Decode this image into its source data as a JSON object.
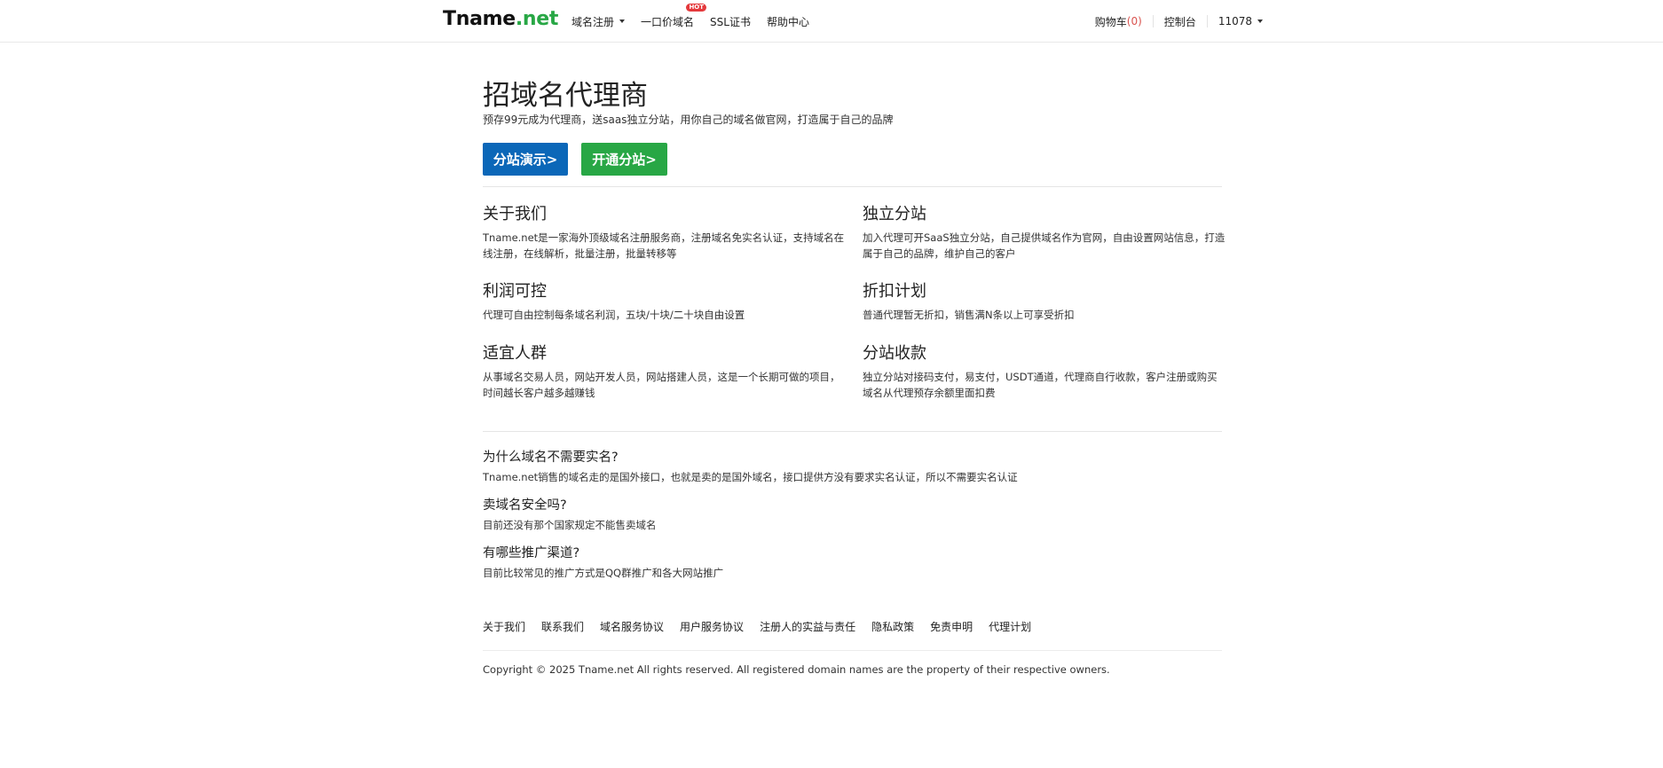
{
  "header": {
    "logo_main": "Tname",
    "logo_suffix": ".net",
    "nav": [
      {
        "label": "域名注册",
        "has_caret": true
      },
      {
        "label": "一口价域名",
        "badge": "HOT"
      },
      {
        "label": "SSL证书"
      },
      {
        "label": "帮助中心"
      }
    ],
    "cart_label": "购物车",
    "cart_count": "(0)",
    "console_label": "控制台",
    "user_label": "11078"
  },
  "hero": {
    "title": "招域名代理商",
    "subtitle": "预存99元成为代理商，送saas独立分站，用你自己的域名做官网，打造属于自己的品牌",
    "demo_button": "分站演示>",
    "open_button": "开通分站>"
  },
  "features": [
    {
      "title": "关于我们",
      "text": "Tname.net是一家海外顶级域名注册服务商，注册域名免实名认证，支持域名在线注册，在线解析，批量注册，批量转移等"
    },
    {
      "title": "独立分站",
      "text": "加入代理可开SaaS独立分站，自己提供域名作为官网，自由设置网站信息，打造属于自己的品牌，维护自己的客户"
    },
    {
      "title": "利润可控",
      "text": "代理可自由控制每条域名利润，五块/十块/二十块自由设置"
    },
    {
      "title": "折扣计划",
      "text": "普通代理暂无折扣，销售满N条以上可享受折扣"
    },
    {
      "title": "适宜人群",
      "text": "从事域名交易人员，网站开发人员，网站搭建人员，这是一个长期可做的项目，时间越长客户越多越赚钱"
    },
    {
      "title": "分站收款",
      "text": "独立分站对接码支付，易支付，USDT通道，代理商自行收款，客户注册或购买域名从代理预存余额里面扣费"
    }
  ],
  "faq": [
    {
      "q": "为什么域名不需要实名?",
      "a": "Tname.net销售的域名走的是国外接口，也就是卖的是国外域名，接口提供方没有要求实名认证，所以不需要实名认证"
    },
    {
      "q": "卖域名安全吗?",
      "a": "目前还没有那个国家规定不能售卖域名"
    },
    {
      "q": "有哪些推广渠道?",
      "a": "目前比较常见的推广方式是QQ群推广和各大网站推广"
    }
  ],
  "footer": {
    "links": [
      "关于我们",
      "联系我们",
      "域名服务协议",
      "用户服务协议",
      "注册人的实益与责任",
      "隐私政策",
      "免责申明",
      "代理计划"
    ],
    "copyright": "Copyright © 2025 Tname.net All rights reserved. All registered domain names are the property of their respective owners."
  }
}
